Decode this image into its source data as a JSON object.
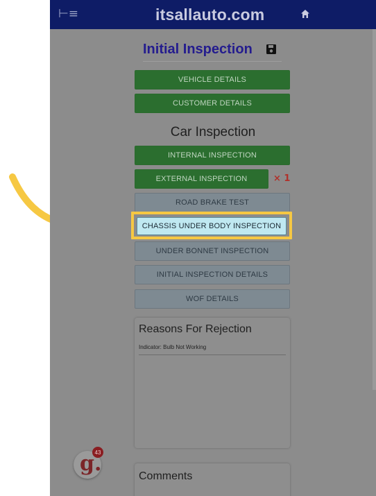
{
  "header": {
    "menu_icon": "menu-collapse-icon",
    "brand": "itsallauto.com",
    "home_icon": "home-icon"
  },
  "page": {
    "title": "Initial Inspection",
    "save_icon": "save-icon"
  },
  "top_buttons": [
    {
      "label": "VEHICLE DETAILS"
    },
    {
      "label": "CUSTOMER DETAILS"
    }
  ],
  "section": {
    "title": "Car Inspection"
  },
  "inspection_buttons": [
    {
      "label": "INTERNAL INSPECTION"
    },
    {
      "label": "EXTERNAL INSPECTION",
      "mark": "× 1"
    },
    {
      "label": "ROAD BRAKE TEST"
    },
    {
      "label": "CHASSIS UNDER BODY INSPECTION"
    },
    {
      "label": "UNDER BONNET INSPECTION"
    },
    {
      "label": "INITIAL INSPECTION DETAILS"
    },
    {
      "label": "WOF DETAILS"
    }
  ],
  "reasons": {
    "title": "Reasons For Rejection",
    "items": [
      "Indicator: Bulb Not Working"
    ]
  },
  "comments": {
    "title": "Comments"
  },
  "avatar": {
    "letter": "g.",
    "badge": "43"
  },
  "colors": {
    "highlight": "#f6c843",
    "header": "#0e1c66",
    "green": "#2b6e2f"
  }
}
